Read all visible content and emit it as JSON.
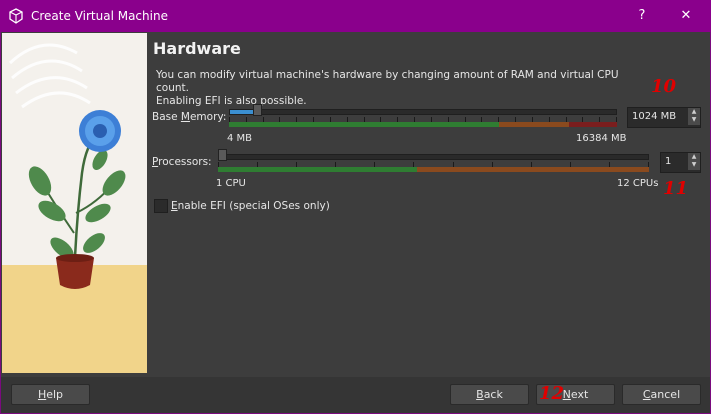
{
  "window": {
    "title": "Create Virtual Machine",
    "help_glyph": "?",
    "close_glyph": "✕"
  },
  "page": {
    "heading": "Hardware",
    "description_line1": "You can modify virtual machine's hardware by changing amount of RAM and virtual CPU count.",
    "description_line2": "Enabling EFI is also possible."
  },
  "memory": {
    "label_pre": "Base ",
    "label_access": "M",
    "label_post": "emory:",
    "min_label": "4 MB",
    "max_label": "16384 MB",
    "value": "1024 MB",
    "level": 0.0623
  },
  "processors": {
    "label_access": "P",
    "label_post": "rocessors:",
    "min_label": "1 CPU",
    "max_label": "12 CPUs",
    "value": "1",
    "level": 0.0
  },
  "efi": {
    "label_pre": "",
    "label_access": "E",
    "label_post": "nable EFI (special OSes only)",
    "checked": false
  },
  "annotations": {
    "memory_marker": "10",
    "processors_marker": "11",
    "next_marker": "12"
  },
  "buttons": {
    "help_access": "H",
    "help_post": "elp",
    "back_access": "B",
    "back_post": "ack",
    "next_access": "N",
    "next_post": "ext",
    "cancel_access": "C",
    "cancel_post": "ancel"
  },
  "colors": {
    "titlebar": "#8a008c",
    "background": "#3d3d3d",
    "slider_green": "#2f7d32",
    "slider_orange": "#8a4a1e",
    "slider_red": "#7a1e1e",
    "accent_blue": "#3b8fd0",
    "annotation_red": "#e00000"
  }
}
